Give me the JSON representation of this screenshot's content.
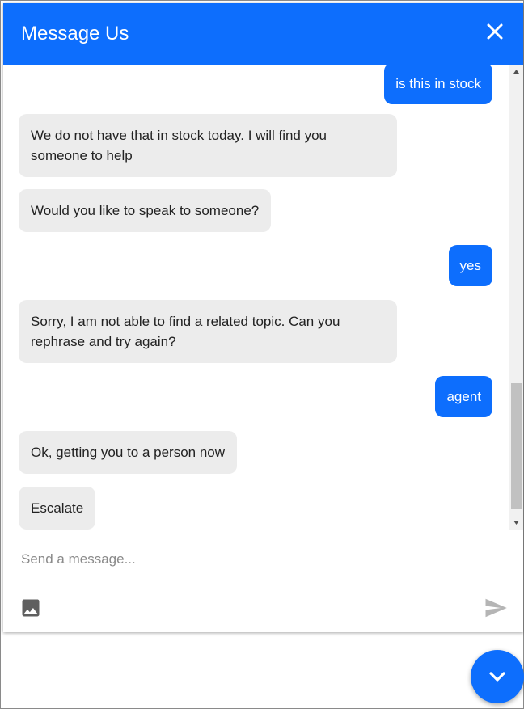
{
  "header": {
    "title": "Message Us",
    "close_icon": "close-icon"
  },
  "conversation": {
    "messages": [
      {
        "sender": "user",
        "text": "is this in stock"
      },
      {
        "sender": "bot",
        "text": "We do not have that in stock today. I will find you someone to help"
      },
      {
        "sender": "bot",
        "text": "Would you like to speak to someone?"
      },
      {
        "sender": "user",
        "text": "yes"
      },
      {
        "sender": "bot",
        "text": "Sorry, I am not able to find a related topic. Can you rephrase and try again?"
      },
      {
        "sender": "user",
        "text": "agent"
      },
      {
        "sender": "bot",
        "text": "Ok, getting you to a person now"
      },
      {
        "sender": "bot",
        "text": "Escalate"
      }
    ]
  },
  "composer": {
    "placeholder": "Send a message...",
    "value": "",
    "image_icon": "image-icon",
    "send_icon": "send-icon"
  },
  "launcher": {
    "icon": "chevron-down-icon"
  },
  "colors": {
    "accent": "#0d6efd",
    "bot_bubble": "#ececec",
    "bot_text": "#222222",
    "user_text": "#ffffff"
  }
}
